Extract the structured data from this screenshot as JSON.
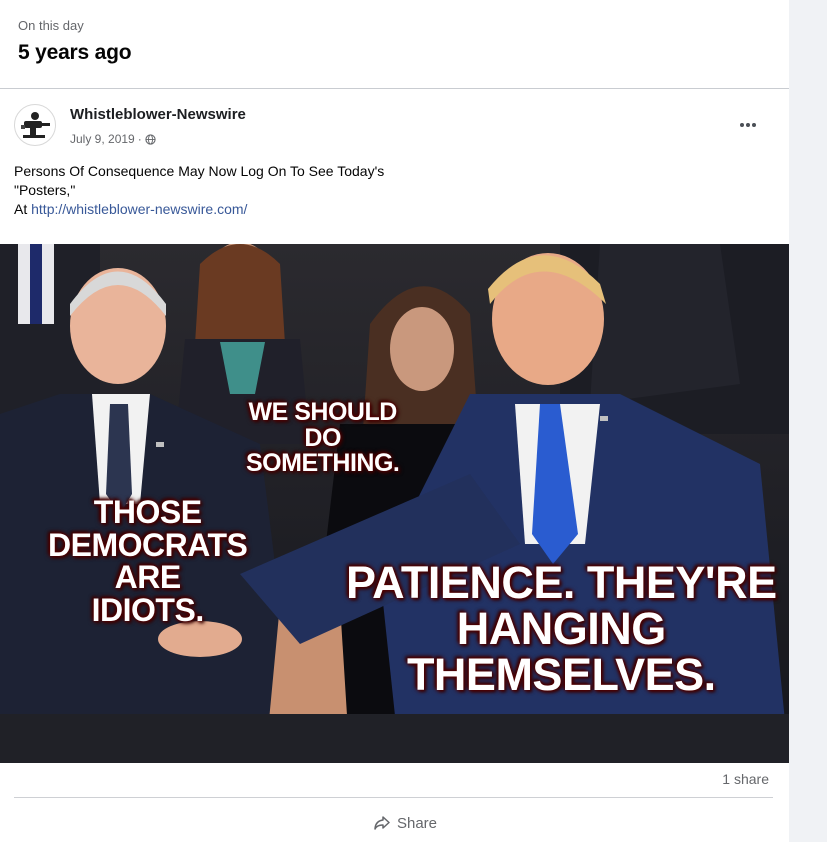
{
  "memory": {
    "label": "On this day",
    "title": "5 years ago"
  },
  "post": {
    "author": "Whistleblower-Newswire",
    "date": "July 9, 2019",
    "separator": "·",
    "text_line1": "Persons Of Consequence May Now Log On To See Today's",
    "text_line2": "\"Posters,\"",
    "text_line3_prefix": "At ",
    "link": "http://whistleblower-newswire.com/",
    "more_icon": "ellipsis-icon",
    "privacy_icon": "globe-icon"
  },
  "image": {
    "caption1_line1": "WE SHOULD",
    "caption1_line2": "DO",
    "caption1_line3": "SOMETHING.",
    "caption2_line1": "THOSE",
    "caption2_line2": "DEMOCRATS",
    "caption2_line3": "ARE",
    "caption2_line4": "IDIOTS.",
    "caption3_line1": "PATIENCE. THEY'RE",
    "caption3_line2": "HANGING",
    "caption3_line3": "THEMSELVES."
  },
  "footer": {
    "shares": "1 share",
    "share_label": "Share",
    "share_icon": "share-arrow-icon"
  }
}
